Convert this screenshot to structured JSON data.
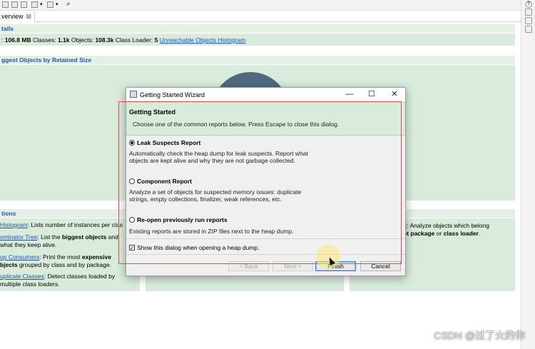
{
  "toolbar": {
    "icons": [
      "memory-analyzer-icon",
      "open-dump-icon",
      "histogram-icon",
      "dominator-icon",
      "dropdown-icon",
      "query-icon",
      "dropdown-icon",
      "search-icon"
    ]
  },
  "editor": {
    "tab_label": "verview",
    "tab_close": "⊠",
    "details": {
      "header": "tails",
      "size_label": ":",
      "size_value": "106.8 MB",
      "classes_label": "Classes:",
      "classes_value": "1.1k",
      "objects_label": "Objects:",
      "objects_value": "108.3k",
      "loader_label": "Class Loader:",
      "loader_value": "5",
      "unreachable_link": "Unreachable Objects Histogram"
    },
    "biggest_objects_header": "ggest Objects by Retained Size",
    "actions_header": "tions",
    "actions": [
      {
        "link": "Histogram",
        "text": ": Lists number of instances per clas"
      },
      {
        "link": "ominator Tree",
        "text_a": ": List the ",
        "bold": "biggest objects",
        "text_b": " and",
        "line2": "what they keep alive."
      },
      {
        "link": "op Consumers",
        "text_a": ": Print the most ",
        "bold": "expensive",
        "line2_bold": "bjects",
        "line2": " grouped by class and by package."
      },
      {
        "link": "uplicate Classes",
        "text": ": Detect classes loaded by",
        "line2": "multiple class loaders."
      }
    ],
    "right_action": {
      "link": "rt",
      "text": ": Analyze objects which belong",
      "bold1": "ot package",
      "mid": " or ",
      "bold2": "class loader",
      "end": "."
    }
  },
  "dialog": {
    "title": "Getting Started Wizard",
    "minimize": "—",
    "maximize": "☐",
    "close": "✕",
    "banner_title": "Getting Started",
    "banner_desc": "Choose one of the common reports below. Press Escape to close this dialog.",
    "options": [
      {
        "label": "Leak Suspects Report",
        "selected": true,
        "desc": "Automatically check the heap dump for leak suspects. Report what objects are kept alive and why they are not garbage collected."
      },
      {
        "label": "Component Report",
        "selected": false,
        "desc": "Analyze a set of objects for suspected memory issues: duplicate strings, empty collections, finalizer, weak references, etc."
      },
      {
        "label": "Re-open previously run reports",
        "selected": false,
        "desc": "Existing reports are stored in ZIP files next to the heap dump."
      }
    ],
    "checkbox_label": "Show this dialog when opening a heap dump.",
    "checkbox_checked": "✓",
    "buttons": {
      "back": "< Back",
      "next": "Next >",
      "finish": "Finish",
      "cancel": "Cancel"
    }
  },
  "watermark": "CSDN @过了火的你",
  "right_strip": {
    "help": "?"
  }
}
